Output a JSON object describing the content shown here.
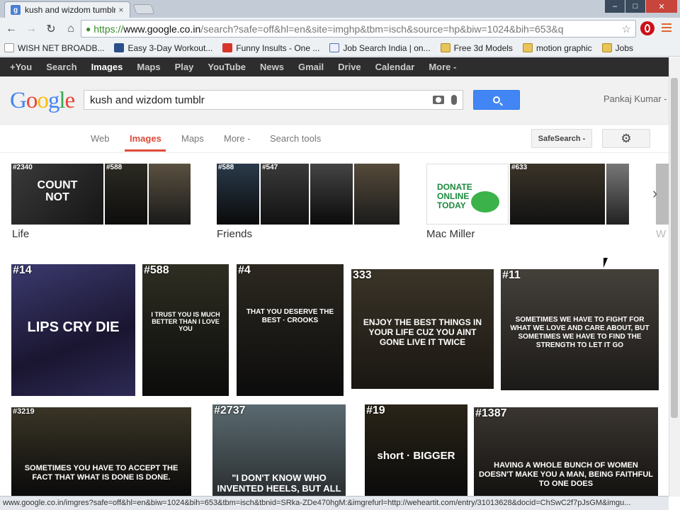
{
  "browser": {
    "tab_title": "kush and wizdom tumblr",
    "tab_favicon": "g",
    "tab_close": "×",
    "win_min": "–",
    "win_max": "□",
    "win_close": "✕",
    "url_scheme": "https://",
    "url_host": "www.google.co.in",
    "url_path": "/search?safe=off&hl=en&site=imghp&tbm=isch&source=hp&biw=1024&bih=653&q",
    "star": "☆",
    "back": "←",
    "forward": "→",
    "reload": "↻",
    "home": "⌂",
    "bookmarks": [
      {
        "label": "WISH NET BROADB...",
        "icon": "page"
      },
      {
        "label": "Easy 3-Day Workout...",
        "icon": "img"
      },
      {
        "label": "Funny Insults - One ...",
        "icon": "red"
      },
      {
        "label": "Job Search India | on...",
        "icon": "info"
      },
      {
        "label": "Free 3d Models",
        "icon": "folder"
      },
      {
        "label": "motion graphic",
        "icon": "folder"
      },
      {
        "label": "Jobs",
        "icon": "folder"
      }
    ],
    "status_url": "www.google.co.in/imgres?safe=off&hl=en&biw=1024&bih=653&tbm=isch&tbnid=SRka-ZDe470hgM:&imgrefurl=http://weheartit.com/entry/31013628&docid=ChSwC2f7pJsGM&imgu..."
  },
  "gbar": {
    "items": [
      "+You",
      "Search",
      "Images",
      "Maps",
      "Play",
      "YouTube",
      "News",
      "Gmail",
      "Drive",
      "Calendar",
      "More -"
    ],
    "active_index": 2
  },
  "search": {
    "logo": "Google",
    "query": "kush and wizdom tumblr",
    "user": "Pankaj Kumar -"
  },
  "tabs": {
    "items": [
      "Web",
      "Images",
      "Maps",
      "More -",
      "Search tools"
    ],
    "active": "Images",
    "safesearch": "SafeSearch -",
    "settings_icon": "⚙"
  },
  "related": {
    "groups": [
      {
        "label": "Life",
        "tags": [
          "#2340",
          "#588",
          ""
        ]
      },
      {
        "label": "Friends",
        "tags": [
          "#588",
          "#547",
          "",
          ""
        ]
      },
      {
        "label": "Mac Miller",
        "tags": [
          "",
          "#633",
          ""
        ]
      }
    ],
    "partial_label": "W",
    "next": "›",
    "tile_texts": {
      "count_not": "COUNT NOT",
      "donate": "DONATE ONLINE TODAY"
    }
  },
  "grid": {
    "row1": [
      {
        "tag": "#14",
        "quote": "LIPS CRY DIE"
      },
      {
        "tag": "#588",
        "quote": "I trust you is much better than I love you"
      },
      {
        "tag": "#4",
        "quote": "That you deserve the best · Crooks"
      },
      {
        "tag": "333",
        "quote": "Enjoy the best things in your life cuz you aint gone live it twice"
      },
      {
        "tag": "#11",
        "quote": "Sometimes we have to fight for what we love and care about, but sometimes we have to find the strength to let it go"
      }
    ],
    "row2": [
      {
        "tag": "#3219",
        "quote": "Sometimes you have to accept the fact that what is done is done."
      },
      {
        "tag": "#2737",
        "quote": "\"I don't know who invented heels, but all"
      },
      {
        "tag": "#19",
        "quote": "short · BIGGER"
      },
      {
        "tag": "#1387",
        "quote": "Having a whole bunch of women doesn't make you a man, being faithful to one does"
      }
    ]
  }
}
